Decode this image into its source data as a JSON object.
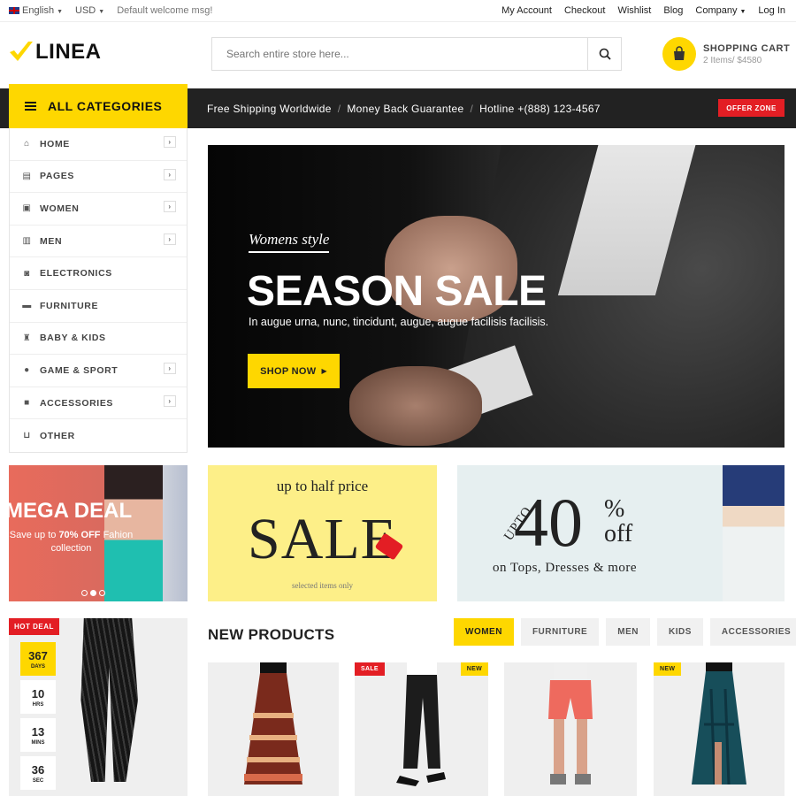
{
  "topbar": {
    "language": "English",
    "currency": "USD",
    "welcome": "Default welcome msg!",
    "links": [
      "My Account",
      "Checkout",
      "Wishlist",
      "Blog",
      "Company",
      "Log In"
    ]
  },
  "header": {
    "logo": "LINEA",
    "search_placeholder": "Search entire store here...",
    "cart_title": "SHOPPING CART",
    "cart_summary": "2 Items/ $4580"
  },
  "navbar": {
    "all_categories": "ALL CATEGORIES",
    "info": [
      "Free Shipping Worldwide",
      "Money Back Guarantee",
      "Hotline +(888) 123-4567"
    ],
    "offer": "OFFER ZONE"
  },
  "sidebar": {
    "items": [
      {
        "label": "HOME",
        "icon": "home-icon",
        "arrow": true
      },
      {
        "label": "PAGES",
        "icon": "file-icon",
        "arrow": true
      },
      {
        "label": "WOMEN",
        "icon": "gift-icon",
        "arrow": true
      },
      {
        "label": "MEN",
        "icon": "briefcase-icon",
        "arrow": true
      },
      {
        "label": "ELECTRONICS",
        "icon": "camera-icon",
        "arrow": false
      },
      {
        "label": "FURNITURE",
        "icon": "bed-icon",
        "arrow": false
      },
      {
        "label": "BABY & KIDS",
        "icon": "child-icon",
        "arrow": false
      },
      {
        "label": "GAME & SPORT",
        "icon": "soccer-icon",
        "arrow": true
      },
      {
        "label": "ACCESSORIES",
        "icon": "archive-icon",
        "arrow": true
      },
      {
        "label": "OTHER",
        "icon": "basket-icon",
        "arrow": false
      }
    ]
  },
  "hero": {
    "subtitle": "Womens style",
    "title": "SEASON SALE",
    "description": "In augue urna, nunc, tincidunt, augue, augue facilisis facilisis.",
    "button": "SHOP NOW"
  },
  "banner_mega": {
    "title": "MEGA DEAL",
    "text_prefix": "Save up to ",
    "text_highlight": "70% OFF",
    "text_suffix": " Fahion collection"
  },
  "banner_sale": {
    "top": "up to half price",
    "main": "SALE",
    "bottom": "selected items only"
  },
  "banner_40": {
    "upto": "UPTO",
    "number": "40",
    "percent": "%",
    "off": "off",
    "bottom": "on Tops, Dresses & more"
  },
  "hot_deal": {
    "label": "HOT DEAL",
    "timer": [
      {
        "value": "367",
        "unit": "DAYS"
      },
      {
        "value": "10",
        "unit": "HRS"
      },
      {
        "value": "13",
        "unit": "MINS"
      },
      {
        "value": "36",
        "unit": "SEC"
      }
    ]
  },
  "new_products": {
    "title": "NEW PRODUCTS",
    "tabs": [
      "WOMEN",
      "FURNITURE",
      "MEN",
      "KIDS",
      "ACCESSORIES"
    ],
    "active_tab": "WOMEN",
    "items": [
      {
        "badge": ""
      },
      {
        "badge": "SALE"
      },
      {
        "badge": "NEW"
      },
      {
        "badge": ""
      },
      {
        "badge": "NEW"
      }
    ]
  },
  "colors": {
    "accent": "#fed700",
    "red": "#e31e24",
    "dark": "#222222"
  }
}
